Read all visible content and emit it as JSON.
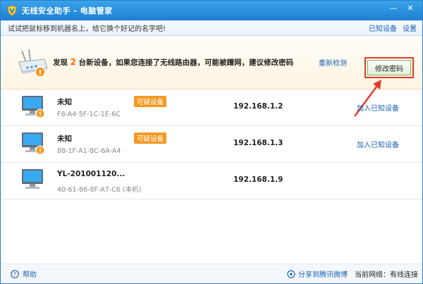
{
  "window": {
    "title": "无线安全助手 - 电脑管家",
    "controls": {
      "minimize": "—",
      "close": "✕"
    }
  },
  "tipbar": {
    "text": "试试把鼠标移到机器名上，给它换个好记的名字吧!",
    "known_devices_link": "已知设备",
    "settings_link": "设置"
  },
  "alert": {
    "prefix": "发现",
    "count": "2",
    "suffix": "台新设备，如果您连接了无线路由器，可能被蹭网，建议修改密码",
    "rescan_link": "重新检测",
    "change_password_button": "修改密码"
  },
  "devices": [
    {
      "name": "未知",
      "tag": "可疑设备",
      "mac": "F8-A4-5F-1C-1E-6C",
      "ip": "192.168.1.2",
      "action": "加入已知设备"
    },
    {
      "name": "未知",
      "tag": "可疑设备",
      "mac": "88-1F-A1-8C-6A-A4",
      "ip": "192.168.1.3",
      "action": "加入已知设备"
    },
    {
      "name": "YL-201001120...",
      "tag": "",
      "mac": "40-61-86-8F-A7-C6 (本机)",
      "ip": "192.168.1.9",
      "action": ""
    }
  ],
  "footer": {
    "help": "帮助",
    "share": "分享到腾讯微博",
    "network_label": "当前网络：有线连接"
  },
  "colors": {
    "titlebar": "#1d7fd2",
    "accent_orange": "#f19a24",
    "link_blue": "#1a62b4",
    "highlight_red": "#e03c2b"
  },
  "icons": {
    "logo": "shield-v-icon",
    "router": "router-icon",
    "computer": "computer-icon",
    "warning": "warning-badge-icon",
    "help": "help-icon",
    "share": "weibo-icon"
  }
}
